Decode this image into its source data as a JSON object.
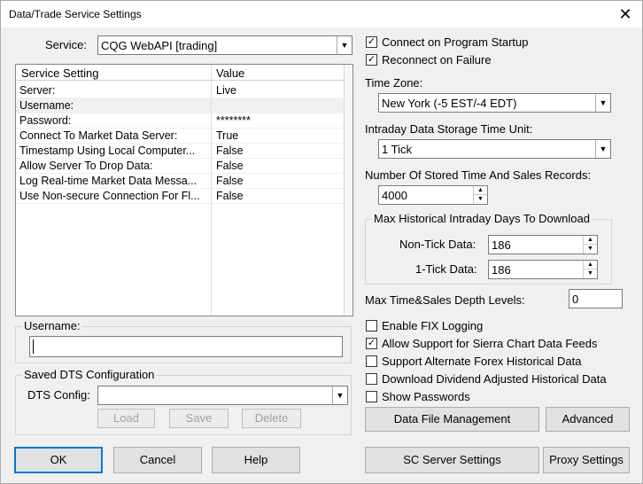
{
  "window": {
    "title": "Data/Trade Service Settings",
    "close_glyph": "✕"
  },
  "service": {
    "label": "Service:",
    "value": "CQG WebAPI   [trading]"
  },
  "grid": {
    "headers": [
      "Service Setting",
      "Value"
    ],
    "rows": [
      {
        "name": "Server:",
        "value": "Live"
      },
      {
        "name": "Username:",
        "value": ""
      },
      {
        "name": "Password:",
        "value": "********"
      },
      {
        "name": "Connect To Market Data Server:",
        "value": "True"
      },
      {
        "name": "Timestamp Using Local Computer...",
        "value": "False"
      },
      {
        "name": "Allow Server To Drop Data:",
        "value": "False"
      },
      {
        "name": "Log Real-time Market Data Messa...",
        "value": "False"
      },
      {
        "name": "Use Non-secure Connection For Fl...",
        "value": "False"
      }
    ]
  },
  "username_group": {
    "legend": "Username:",
    "value": ""
  },
  "dts_group": {
    "legend": "Saved DTS Configuration",
    "config_label": "DTS Config:",
    "config_value": "",
    "load": "Load",
    "save": "Save",
    "delete": "Delete"
  },
  "right": {
    "connect_startup": {
      "label": "Connect on Program Startup",
      "checked": true
    },
    "reconnect_failure": {
      "label": "Reconnect on Failure",
      "checked": true
    },
    "timezone": {
      "label": "Time Zone:",
      "value": "New York (-5 EST/-4 EDT)"
    },
    "storage_unit": {
      "label": "Intraday Data Storage Time Unit:",
      "value": "1 Tick"
    },
    "stored_records": {
      "label": "Number Of Stored Time And Sales Records:",
      "value": "4000"
    },
    "max_hist_group": {
      "legend": "Max Historical Intraday Days To Download",
      "non_tick_label": "Non-Tick Data:",
      "non_tick_value": "186",
      "one_tick_label": "1-Tick Data:",
      "one_tick_value": "186"
    },
    "depth_levels": {
      "label": "Max Time&Sales Depth Levels:",
      "value": "0"
    },
    "checks": [
      {
        "label": "Enable FIX Logging",
        "checked": false
      },
      {
        "label": "Allow Support for Sierra Chart Data Feeds",
        "checked": true
      },
      {
        "label": "Support Alternate Forex Historical Data",
        "checked": false
      },
      {
        "label": "Download Dividend Adjusted Historical Data",
        "checked": false
      },
      {
        "label": "Show Passwords",
        "checked": false
      }
    ],
    "data_file_mgmt": "Data File Management",
    "advanced": "Advanced"
  },
  "bottom": {
    "ok": "OK",
    "cancel": "Cancel",
    "help": "Help",
    "sc_server": "SC Server Settings",
    "proxy": "Proxy Settings"
  },
  "glyphs": {
    "check": "✓",
    "dropdown": "▼",
    "spin_up": "▲",
    "spin_down": "▼"
  }
}
